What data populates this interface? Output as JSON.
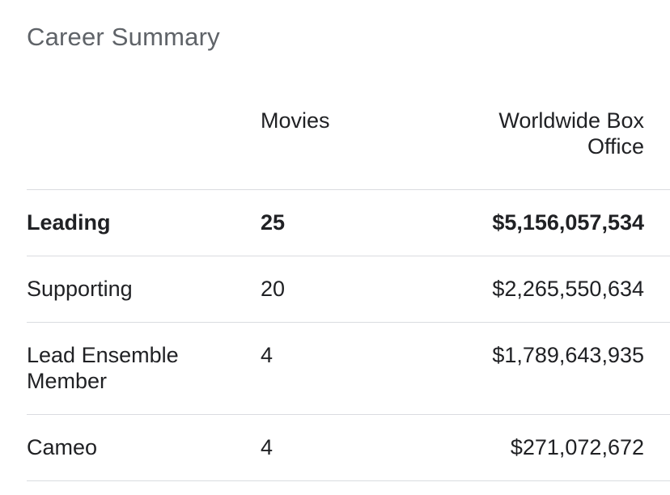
{
  "card": {
    "title": "Career Summary"
  },
  "table": {
    "headers": {
      "role": "",
      "movies": "Movies",
      "box_office": "Worldwide Box Office"
    },
    "rows": [
      {
        "role": "Leading",
        "movies": "25",
        "box_office": "$5,156,057,534",
        "emphasis": true
      },
      {
        "role": "Supporting",
        "movies": "20",
        "box_office": "$2,265,550,634",
        "emphasis": false
      },
      {
        "role": "Lead Ensemble Member",
        "movies": "4",
        "box_office": "$1,789,643,935",
        "emphasis": false
      },
      {
        "role": "Cameo",
        "movies": "4",
        "box_office": "$271,072,672",
        "emphasis": false
      }
    ]
  }
}
